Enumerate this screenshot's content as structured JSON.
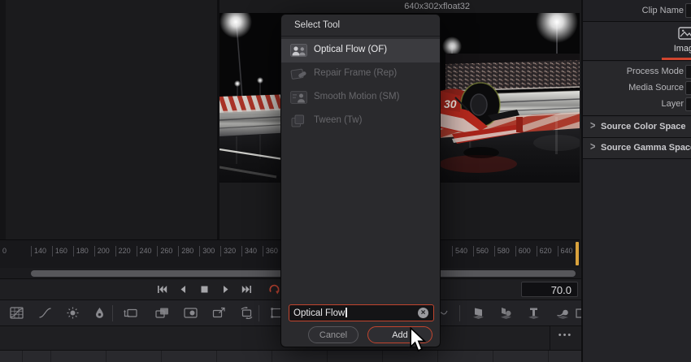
{
  "icons": {
    "options_menu": "•••",
    "section_chevron": ">",
    "clear_input": "×"
  },
  "viewer": {
    "resolution_label": "640x302xfloat32",
    "car_number": "30"
  },
  "inspector": {
    "clip_name_label": "Clip Name",
    "image_tab_label": "Image",
    "field_labels": [
      "Process Mode",
      "Media Source",
      "Layer"
    ],
    "section_labels": [
      "Source Color Space",
      "Source Gamma Space"
    ],
    "accent_color": "#d0452f"
  },
  "timeline": {
    "partial_tick_label": "0",
    "ticks": [
      "140",
      "160",
      "180",
      "200",
      "220",
      "240",
      "260",
      "280",
      "300",
      "320",
      "340",
      "360",
      "540",
      "560",
      "580",
      "600",
      "620",
      "640"
    ],
    "end_marker_color": "#d9a23c"
  },
  "transport": {
    "speed_value": "70.0"
  },
  "dialog": {
    "title": "Select Tool",
    "items": [
      {
        "label": "Optical Flow (OF)",
        "selected": true
      },
      {
        "label": "Repair Frame (Rep)",
        "selected": false
      },
      {
        "label": "Smooth Motion (SM)",
        "selected": false
      },
      {
        "label": "Tween (Tw)",
        "selected": false
      }
    ],
    "input_value": "Optical Flow",
    "cancel_label": "Cancel",
    "add_label": "Add",
    "accent_color": "#c2452e"
  }
}
